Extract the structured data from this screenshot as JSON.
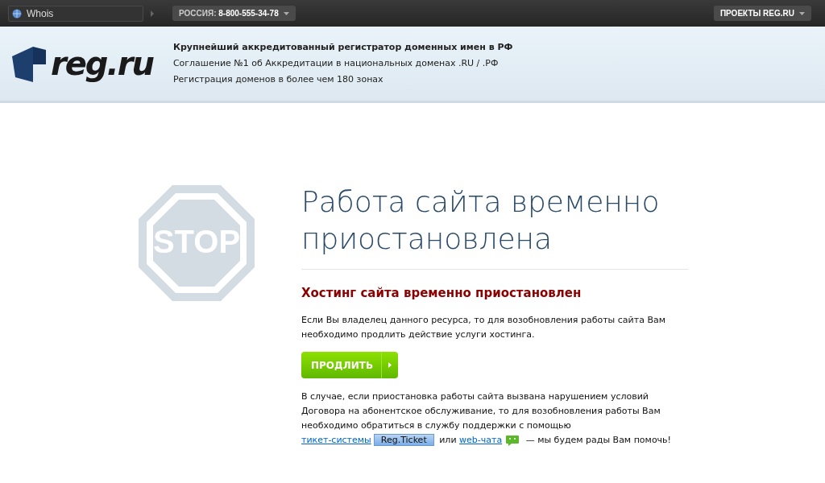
{
  "topbar": {
    "search": {
      "value": "Whois"
    },
    "phone": "РОССИЯ: **8-800-555-34-78**",
    "projects": "ПРОЕКТЫ REG.RU"
  },
  "header": {
    "logo": "reg.ru",
    "lines": [
      "Крупнейший аккредитованный регистратор доменных имен в РФ",
      "Соглашение №1 об Аккредитации в национальных доменах .RU / .РФ",
      "Регистрация доменов в более чем 180 зонах"
    ]
  },
  "main": {
    "sign": "STOP",
    "title": "Работа сайта временно приостановлена",
    "subtitle": "Хостинг сайта временно приостановлен",
    "intro": "Если Вы владелец данного ресурса, то для возобновления работы сайта Вам необходимо продлить действие услуги хостинга.",
    "button": "ПРОДЛИТЬ",
    "support": [
      {
        "kind": "text",
        "text": "В случае, если приостановка работы сайта вызвана нарушением условий Договора на абонентское обслуживание, то для возобновления работы Вам необходимо обратиться в службу поддержки с помощью "
      },
      {
        "kind": "link",
        "text": "тикет-системы"
      },
      {
        "kind": "badge",
        "text": "Reg.Ticket"
      },
      {
        "kind": "text",
        "text": " или "
      },
      {
        "kind": "link",
        "text": "web-чата"
      },
      {
        "kind": "chat"
      },
      {
        "kind": "text",
        "text": " — мы будем рады Вам помочь!"
      }
    ]
  }
}
